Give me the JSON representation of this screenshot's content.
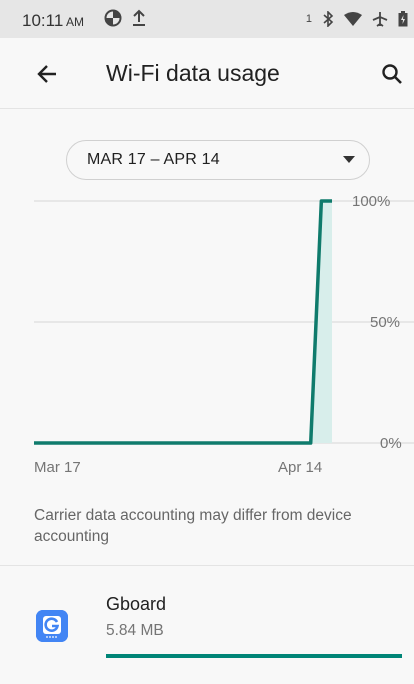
{
  "status_bar": {
    "time": "10:11",
    "ampm": "AM",
    "notification_count": "1"
  },
  "app_bar": {
    "title": "Wi-Fi data usage"
  },
  "cycle": {
    "selected": "MAR 17 – APR 14"
  },
  "chart_data": {
    "type": "line",
    "x_labels": [
      "Mar 17",
      "Apr 14"
    ],
    "y_tick_labels": [
      "100%",
      "50%",
      "0%"
    ],
    "ylim": [
      0,
      100
    ],
    "grid": true,
    "series": [
      {
        "x": [
          "Mar 17",
          "Apr 12",
          "Apr 13",
          "Apr 14"
        ],
        "values": [
          0,
          0,
          100,
          100
        ]
      }
    ],
    "colors": {
      "line": "#0f7b6c",
      "fill": "#d8eeeb"
    }
  },
  "info": {
    "text": "Carrier data accounting may differ from device accounting"
  },
  "apps": [
    {
      "name": "Gboard",
      "usage": "5.84 MB",
      "fraction": 1.0
    }
  ],
  "colors": {
    "accent": "#008577",
    "brand_gboard": "#4285f4"
  }
}
